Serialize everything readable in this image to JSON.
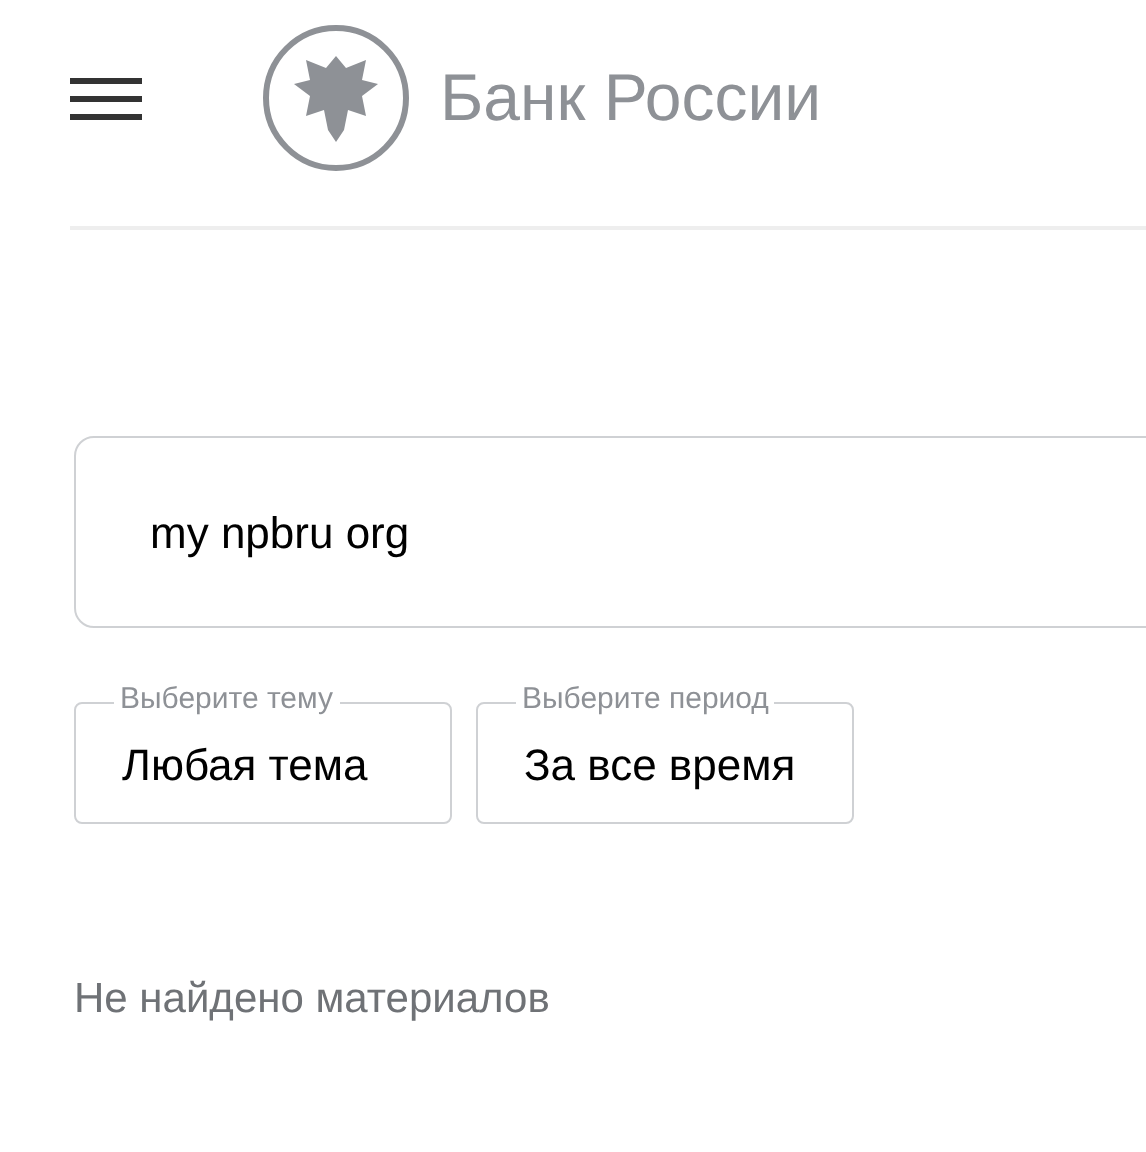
{
  "header": {
    "brand": "Банк России"
  },
  "search": {
    "value": "my npbru org"
  },
  "filters": [
    {
      "label": "Выберите тему",
      "value": "Любая тема"
    },
    {
      "label": "Выберите период",
      "value": "За все время"
    }
  ],
  "result_message": "Не найдено материалов"
}
